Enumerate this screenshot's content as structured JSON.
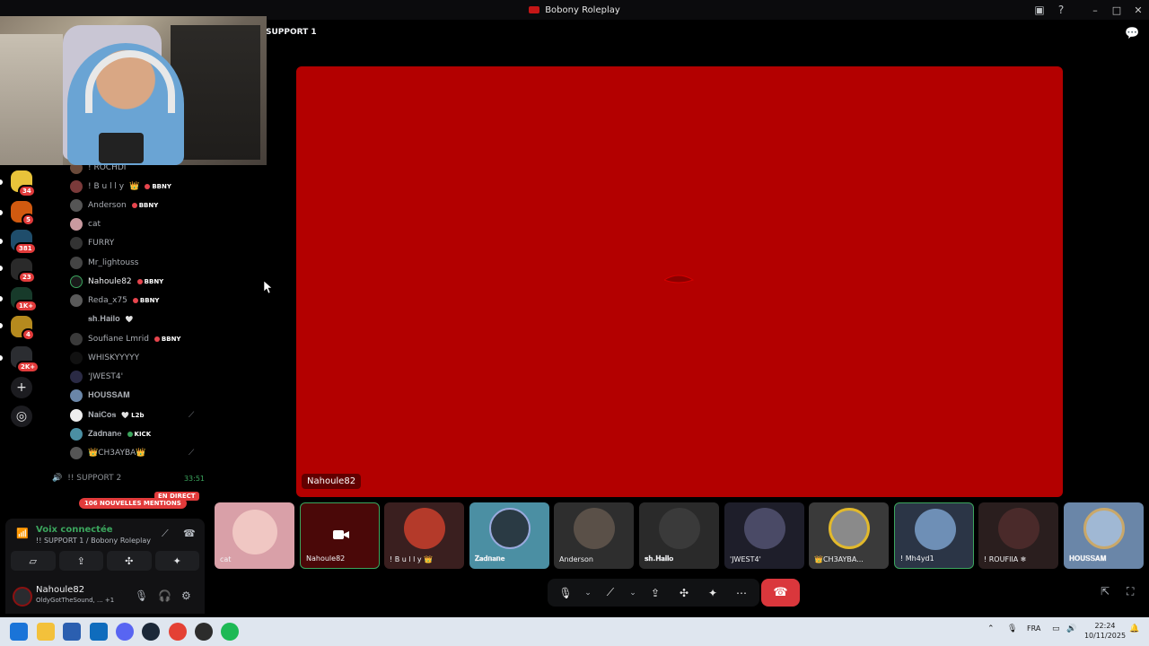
{
  "window": {
    "title": "Bobony Roleplay",
    "channel_title": "SUPPORT 1"
  },
  "rail": {
    "badges": [
      "34",
      "5",
      "381",
      "23",
      "1K+",
      "4",
      "2K+"
    ]
  },
  "members": [
    {
      "name": "! ROCHDI",
      "tag": ""
    },
    {
      "name": "! B u l l y",
      "tag": "BBNY",
      "crown": "👑"
    },
    {
      "name": "Anderson",
      "tag": "BBNY"
    },
    {
      "name": "cat",
      "tag": ""
    },
    {
      "name": "FURRY",
      "tag": ""
    },
    {
      "name": "Mr_lightouss",
      "tag": ""
    },
    {
      "name": "Nahoule82",
      "tag": "BBNY"
    },
    {
      "name": "Reda_x75",
      "tag": "BBNY"
    },
    {
      "name": "𝐬𝐡.𝐇𝐚𝐢𝐥𝐨",
      "tag": "🤍"
    },
    {
      "name": "Soufiane Lmrid",
      "tag": "BBNY"
    },
    {
      "name": "WHISKYYYYY",
      "tag": ""
    },
    {
      "name": "'JWEST4'",
      "tag": ""
    },
    {
      "name": "𝐇𝐎𝐔𝐒𝐒𝐀𝐌",
      "tag": ""
    },
    {
      "name": "𝐍𝐚𝐢𝐂𝐨𝐬",
      "tag": "L2b"
    },
    {
      "name": "𝐙𝐚𝐝𝐧𝐚𝐧𝐞",
      "tag": "KICK"
    },
    {
      "name": "👑CH3AYBA👑",
      "tag": ""
    }
  ],
  "channel2": {
    "name": "!! SUPPORT 2",
    "time": "33:51"
  },
  "mentions": "106 NOUVELLES MENTIONS",
  "live_label": "EN DIRECT",
  "voice": {
    "status": "Voix connectée",
    "location": "!! SUPPORT 1 / Bobony Roleplay"
  },
  "user": {
    "name": "Nahoule82",
    "status": "OldyGotTheSound, ...",
    "extra": "+1"
  },
  "stream": {
    "owner": "Nahoule82"
  },
  "participants": [
    {
      "label": "cat",
      "color": "#d9a0a8"
    },
    {
      "label": "Nahoule82",
      "color": "#4a0808"
    },
    {
      "label": "! B u l l y 👑",
      "color": "#3a1f1f"
    },
    {
      "label": "𝐙𝐚𝐝𝐧𝐚𝐧𝐞",
      "color": "#4b8fa3"
    },
    {
      "label": "Anderson",
      "color": "#2e2e2e"
    },
    {
      "label": "𝐬𝐡.𝐇𝐚𝐢𝐥𝐨",
      "color": "#2a2a2a"
    },
    {
      "label": "'JWEST4'",
      "color": "#1e1e2a"
    },
    {
      "label": "👑CH3AYBA...",
      "color": "#3a3a3a"
    },
    {
      "label": "! Mh4yd1",
      "color": "#2b3546"
    },
    {
      "label": "! ROUFIIA ❄",
      "color": "#2a1e1e"
    },
    {
      "label": "𝐇𝐎𝐔𝐒𝐒𝐀𝐌",
      "color": "#6a86a8"
    }
  ],
  "taskbar": {
    "lang": "FRA",
    "time": "22:24",
    "date": "10/11/2025"
  },
  "colors": {
    "accent_green": "#3ba55d",
    "danger_red": "#da373c",
    "stream_red": "#b30000"
  }
}
